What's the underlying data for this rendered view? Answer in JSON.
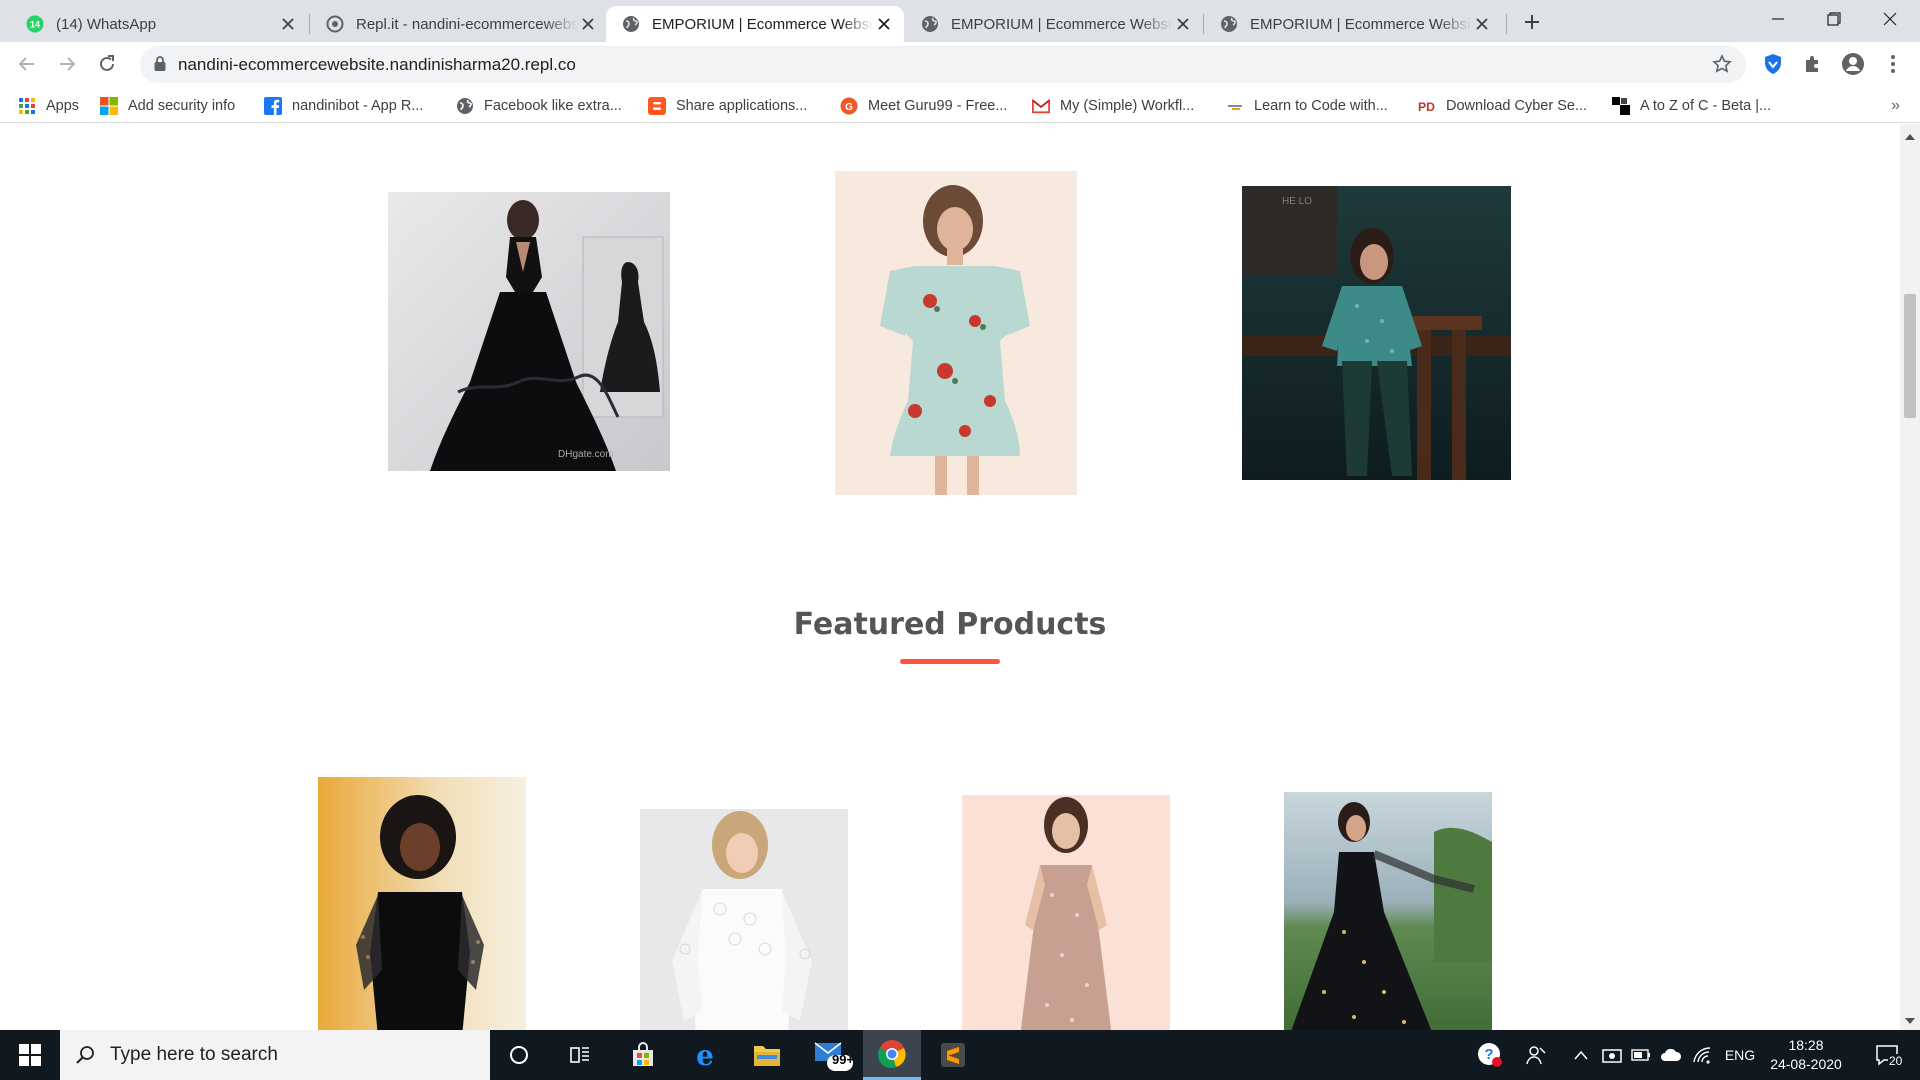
{
  "browser": {
    "tabs": [
      {
        "title": "(14) WhatsApp",
        "icon": "whatsapp-icon",
        "active": false,
        "badge": "14"
      },
      {
        "title": "Repl.it - nandini-ecommercewebsite",
        "icon": "replit-icon",
        "active": false
      },
      {
        "title": "EMPORIUM | Ecommerce Website",
        "icon": "globe-icon",
        "active": true
      },
      {
        "title": "EMPORIUM | Ecommerce Website",
        "icon": "globe-icon",
        "active": false
      },
      {
        "title": "EMPORIUM | Ecommerce Website",
        "icon": "globe-icon",
        "active": false
      }
    ],
    "address_url": "nandini-ecommercewebsite.nandinisharma20.repl.co",
    "bookmarks": [
      {
        "label": "Apps",
        "icon": "apps-grid-icon"
      },
      {
        "label": "Add security info",
        "icon": "microsoft-icon"
      },
      {
        "label": "nandinibot - App R...",
        "icon": "facebook-icon"
      },
      {
        "label": "Facebook like extra...",
        "icon": "globe-icon"
      },
      {
        "label": "Share applications...",
        "icon": "blogger-icon"
      },
      {
        "label": "Meet Guru99 - Free...",
        "icon": "guru99-icon"
      },
      {
        "label": "My (Simple) Workfl...",
        "icon": "gmail-icon"
      },
      {
        "label": "Learn to Code with...",
        "icon": "code-icon"
      },
      {
        "label": "Download Cyber Se...",
        "icon": "pd-icon"
      },
      {
        "label": "A to Z of C - Beta |...",
        "icon": "blocks-icon"
      }
    ],
    "bookmarks_overflow": "»"
  },
  "page": {
    "featured_title": "Featured Products",
    "accent_color": "#ff523b",
    "category_images": [
      {
        "alt": "Black tulle halter gown",
        "watermark": "DHgate.com"
      },
      {
        "alt": "Floral wrap mini dress"
      },
      {
        "alt": "Teal sequin dress in a bar"
      }
    ],
    "product_images": [
      {
        "alt": "Black dress with sheer sleeves"
      },
      {
        "alt": "White lace dress"
      },
      {
        "alt": "Rose gold sequin gown"
      },
      {
        "alt": "Black embellished anarkali"
      }
    ]
  },
  "taskbar": {
    "search_placeholder": "Type here to search",
    "mail_badge": "99+",
    "language": "ENG",
    "time": "18:28",
    "date": "24-08-2020",
    "notifications_count": "20"
  }
}
